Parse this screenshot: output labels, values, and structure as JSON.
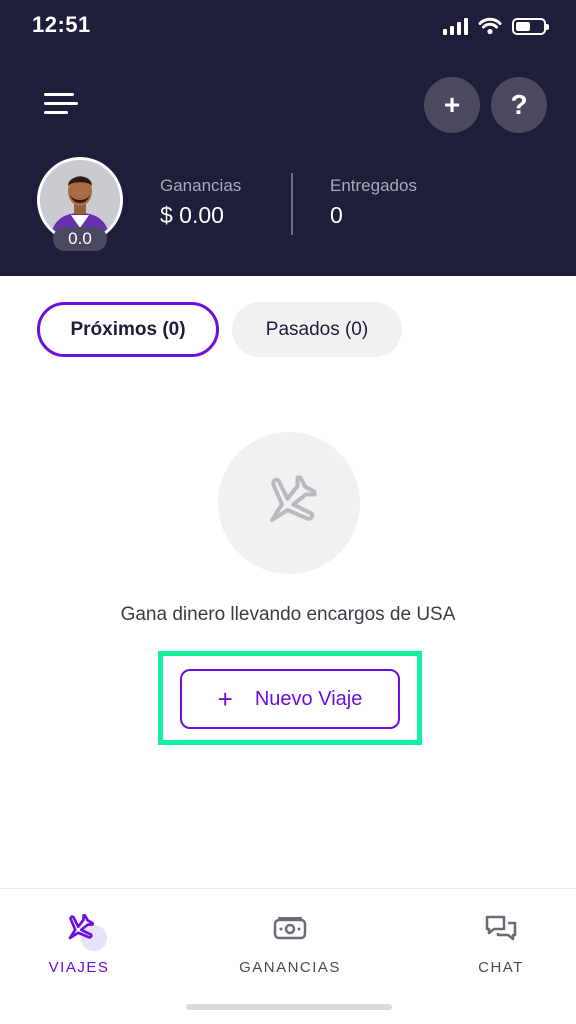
{
  "status_bar": {
    "time": "12:51"
  },
  "header": {
    "rating": "0.0",
    "earnings": {
      "label": "Ganancias",
      "value": "$ 0.00"
    },
    "deliveries": {
      "label": "Entregados",
      "value": "0"
    },
    "add_icon": "+",
    "help_icon": "?"
  },
  "tabs": [
    {
      "label": "Próximos (0)",
      "active": true
    },
    {
      "label": "Pasados (0)",
      "active": false
    }
  ],
  "empty_state": {
    "message": "Gana dinero llevando encargos de USA",
    "button_icon": "+",
    "button_label": "Nuevo Viaje"
  },
  "bottom_nav": [
    {
      "label": "VIAJES",
      "icon": "airplane-icon",
      "active": true
    },
    {
      "label": "GANANCIAS",
      "icon": "money-icon",
      "active": false
    },
    {
      "label": "CHAT",
      "icon": "chat-icon",
      "active": false
    }
  ],
  "colors": {
    "header_bg": "#1e1d3a",
    "accent": "#6a0fe0",
    "highlight": "#14f0a0",
    "muted_bg": "#f1f1f3"
  }
}
